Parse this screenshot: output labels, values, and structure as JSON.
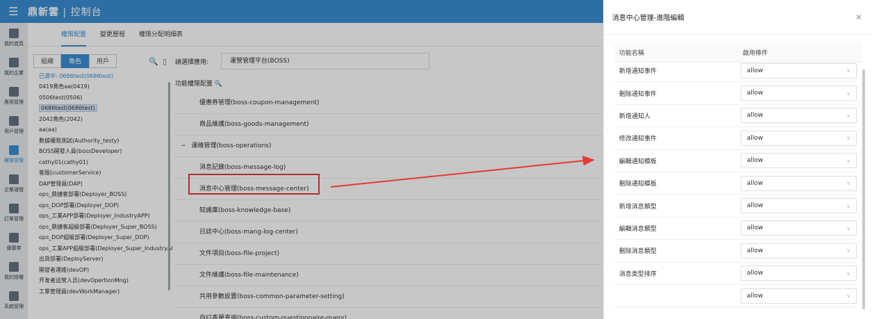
{
  "header": {
    "brand": "鼎新雲",
    "divider": "|",
    "subtitle": "控制台"
  },
  "nav": [
    {
      "label": "我的首頁"
    },
    {
      "label": "我的企業"
    },
    {
      "label": "應用管理"
    },
    {
      "label": "用戶管理"
    },
    {
      "label": "權限管理",
      "active": true
    },
    {
      "label": "企業運營"
    },
    {
      "label": "訂單管理"
    },
    {
      "label": "優惠券"
    },
    {
      "label": "我的授權"
    },
    {
      "label": "系統管理"
    }
  ],
  "tabs": [
    {
      "label": "權限配置",
      "active": true
    },
    {
      "label": "變更歷程"
    },
    {
      "label": "權限分配明細表"
    }
  ],
  "segment": [
    {
      "label": "組織"
    },
    {
      "label": "角色",
      "active": true
    },
    {
      "label": "用戶"
    }
  ],
  "selected_text": "已選中: 0686test(0686test)",
  "roles": [
    "0419角色aa(0419)",
    "0506test(0506)",
    "0686test(0686test)",
    "2042角色(2042)",
    "aa(aa)",
    "數據權限測試(Authority_testy)",
    "BOSS開發人員(bossDeveloper)",
    "cathy01(cathy01)",
    "客服(customerService)",
    "DAP管理員(DAP)",
    "ops_鼎捷客部署(Deployer_BOSS)",
    "ops_DOP部署(Deployer_DOP)",
    "ops_工業APP部署(Deployer_IndustryAPP)",
    "ops_鼎捷客超級部署(Deployer_Super_BOSS)",
    "ops_DOP超級部署(Deployer_Super_DOP)",
    "ops_工業APP超級部署(Deployer_Super_IndustryAPP)",
    "出貨部署(DeployServer)",
    "開發者運維(devOP)",
    "开发者运营人员(devOpertionMng)",
    "工單管理員(devWorkManager)"
  ],
  "app_select": {
    "label": "請選擇應用:",
    "value": "運營管理平台(BOSS)"
  },
  "func_header": "功能權限配置",
  "functions": [
    {
      "label": "優惠券管理(boss-coupon-management)"
    },
    {
      "label": "商品維護(boss-goods-management)"
    },
    {
      "label": "運維管理(boss-operations)",
      "group": true
    },
    {
      "label": "消息記錄(boss-message-log)"
    },
    {
      "label": "消息中心管理(boss-message-center)"
    },
    {
      "label": "知識庫(boss-knowledge-base)"
    },
    {
      "label": "日誌中心(boss-mang-log-center)"
    },
    {
      "label": "文件項目(boss-file-project)"
    },
    {
      "label": "文件維護(boss-file-maintenance)"
    },
    {
      "label": "共用參數設置(boss-common-parameter-setting)"
    },
    {
      "label": "自訂表單查詢(boss-custom-questionnaire-query)"
    }
  ],
  "drawer": {
    "title": "消息中心管理-進階編輯",
    "col_name": "功能名稱",
    "col_cond": "啟用條件",
    "rows": [
      {
        "name": "新增通知事件",
        "value": "allow"
      },
      {
        "name": "刪除通知事件",
        "value": "allow"
      },
      {
        "name": "新增通知人",
        "value": "allow"
      },
      {
        "name": "修改通知事件",
        "value": "allow"
      },
      {
        "name": "編輯通知模板",
        "value": "allow"
      },
      {
        "name": "刪除通知模板",
        "value": "allow"
      },
      {
        "name": "新增消息類型",
        "value": "allow"
      },
      {
        "name": "編輯消息類型",
        "value": "allow"
      },
      {
        "name": "刪除消息類型",
        "value": "allow"
      },
      {
        "name": "消息类型排序",
        "value": "allow"
      },
      {
        "name": "",
        "value": "allow"
      }
    ]
  },
  "colors": {
    "primary": "#3a8fd4",
    "highlight": "#e53935"
  }
}
